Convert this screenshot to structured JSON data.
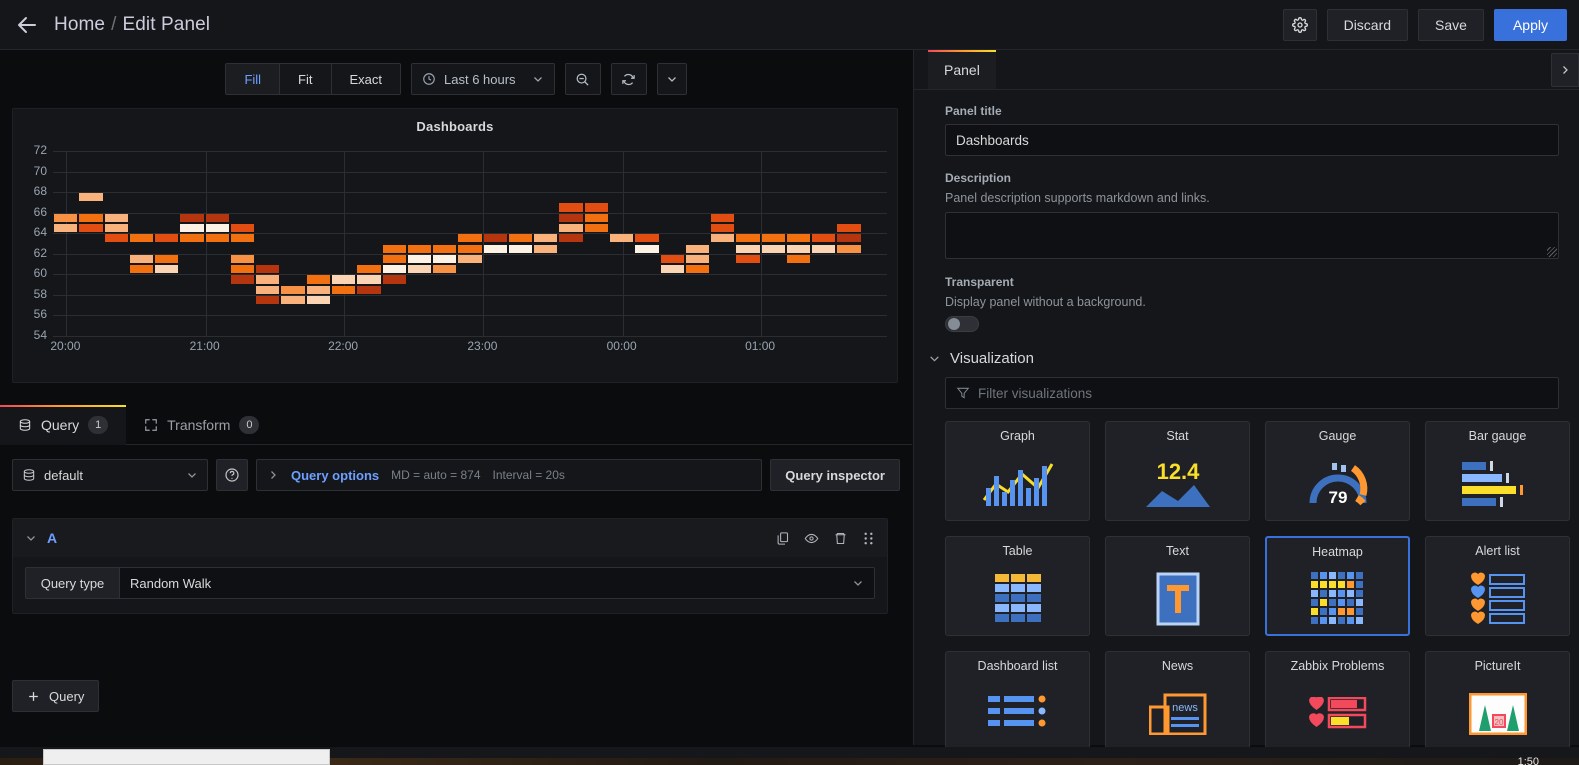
{
  "topnav": {
    "back_icon": "arrow-left-icon",
    "breadcrumb_home": "Home",
    "breadcrumb_sep": "/",
    "breadcrumb_current": "Edit Panel",
    "settings_icon": "gear-icon",
    "discard_label": "Discard",
    "save_label": "Save",
    "apply_label": "Apply",
    "accent_primary": "#3871dc"
  },
  "toolbar": {
    "fit_modes": [
      "Fill",
      "Fit",
      "Exact"
    ],
    "active_fit_mode": "Fill",
    "time_range": "Last 6 hours",
    "clock_icon": "clock-icon",
    "timepicker_caret_icon": "chevron-down-icon",
    "zoom_out_icon": "zoom-out-icon",
    "refresh_icon": "refresh-icon",
    "refresh_caret_icon": "chevron-down-icon"
  },
  "panel": {
    "title": "Dashboards"
  },
  "chart_data": {
    "type": "heatmap",
    "title": "Dashboards",
    "xlabel": "",
    "ylabel": "",
    "grid": true,
    "legend": "none",
    "ylim": [
      54,
      72
    ],
    "ytick_labels": [
      72,
      70,
      68,
      66,
      64,
      62,
      60,
      58,
      56,
      54
    ],
    "xtick_labels": [
      "20:00",
      "21:00",
      "22:00",
      "23:00",
      "00:00",
      "01:00"
    ],
    "xtick_fractions": [
      0.016,
      0.183,
      0.349,
      0.516,
      0.683,
      0.849
    ],
    "bucket_height": 1,
    "color_scale": [
      "#932b0c",
      "#b5350f",
      "#e24d12",
      "#f2700f",
      "#f79245",
      "#f9b27b",
      "#fbd4b4",
      "#fdf2e4"
    ],
    "cells": [
      [
        0,
        65,
        4
      ],
      [
        0,
        64,
        5
      ],
      [
        1,
        67,
        5
      ],
      [
        1,
        65,
        3
      ],
      [
        1,
        64,
        2
      ],
      [
        2,
        65,
        5
      ],
      [
        2,
        64,
        5
      ],
      [
        2,
        63,
        2
      ],
      [
        3,
        63,
        3
      ],
      [
        3,
        61,
        5
      ],
      [
        3,
        60,
        3
      ],
      [
        4,
        63,
        2
      ],
      [
        4,
        61,
        3
      ],
      [
        4,
        60,
        6
      ],
      [
        5,
        65,
        1
      ],
      [
        5,
        63,
        3
      ],
      [
        5,
        64,
        7
      ],
      [
        6,
        65,
        1
      ],
      [
        6,
        64,
        7
      ],
      [
        6,
        63,
        3
      ],
      [
        7,
        64,
        2
      ],
      [
        7,
        63,
        3
      ],
      [
        7,
        61,
        4
      ],
      [
        7,
        60,
        3
      ],
      [
        7,
        59,
        1
      ],
      [
        8,
        60,
        1
      ],
      [
        8,
        59,
        5
      ],
      [
        8,
        58,
        5
      ],
      [
        8,
        57,
        1
      ],
      [
        9,
        58,
        4
      ],
      [
        9,
        57,
        5
      ],
      [
        10,
        58,
        5
      ],
      [
        10,
        57,
        6
      ],
      [
        10,
        59,
        3
      ],
      [
        11,
        58,
        3
      ],
      [
        11,
        59,
        6
      ],
      [
        12,
        59,
        6
      ],
      [
        12,
        58,
        1
      ],
      [
        12,
        60,
        3
      ],
      [
        13,
        59,
        1
      ],
      [
        13,
        60,
        7
      ],
      [
        13,
        61,
        3
      ],
      [
        13,
        62,
        3
      ],
      [
        14,
        60,
        6
      ],
      [
        14,
        61,
        7
      ],
      [
        14,
        62,
        3
      ],
      [
        15,
        60,
        4
      ],
      [
        15,
        61,
        7
      ],
      [
        15,
        62,
        3
      ],
      [
        16,
        61,
        5
      ],
      [
        16,
        62,
        3
      ],
      [
        16,
        63,
        3
      ],
      [
        17,
        62,
        7
      ],
      [
        17,
        63,
        1
      ],
      [
        18,
        62,
        7
      ],
      [
        18,
        63,
        3
      ],
      [
        19,
        62,
        5
      ],
      [
        19,
        63,
        5
      ],
      [
        20,
        64,
        5
      ],
      [
        20,
        65,
        1
      ],
      [
        20,
        66,
        2
      ],
      [
        20,
        63,
        1
      ],
      [
        21,
        65,
        3
      ],
      [
        21,
        66,
        2
      ],
      [
        21,
        64,
        3
      ],
      [
        22,
        63,
        5
      ],
      [
        23,
        63,
        2
      ],
      [
        23,
        62,
        7
      ],
      [
        24,
        61,
        2
      ],
      [
        24,
        60,
        6
      ],
      [
        25,
        61,
        5
      ],
      [
        25,
        62,
        5
      ],
      [
        25,
        60,
        3
      ],
      [
        26,
        63,
        5
      ],
      [
        26,
        64,
        2
      ],
      [
        26,
        65,
        2
      ],
      [
        27,
        63,
        3
      ],
      [
        27,
        62,
        6
      ],
      [
        27,
        61,
        2
      ],
      [
        28,
        63,
        3
      ],
      [
        28,
        62,
        6
      ],
      [
        29,
        63,
        3
      ],
      [
        29,
        62,
        6
      ],
      [
        29,
        61,
        3
      ],
      [
        30,
        63,
        2
      ],
      [
        30,
        62,
        6
      ],
      [
        31,
        63,
        1
      ],
      [
        31,
        64,
        2
      ],
      [
        31,
        62,
        4
      ]
    ]
  },
  "query_section": {
    "tabs": [
      {
        "label": "Query",
        "badge": "1",
        "icon": "database-icon",
        "active": true
      },
      {
        "label": "Transform",
        "badge": "0",
        "icon": "transform-icon",
        "active": false
      }
    ],
    "datasource": "default",
    "datasource_icon": "database-icon",
    "help_icon": "question-circle-icon",
    "expand_icon": "chevron-right-icon",
    "query_options_label": "Query options",
    "query_options_md": "MD = auto = 874",
    "query_options_interval": "Interval = 20s",
    "query_inspector_label": "Query inspector",
    "query_row": {
      "collapse_icon": "chevron-down-icon",
      "ref_id": "A",
      "actions": [
        "copy-icon",
        "eye-icon",
        "trash-icon",
        "drag-handle-icon"
      ],
      "query_type_label": "Query type",
      "query_type_value": "Random Walk",
      "caret_icon": "chevron-down-icon"
    },
    "add_query_label": "Query",
    "add_query_icon": "plus-icon"
  },
  "options_pane": {
    "tab_label": "Panel",
    "collapse_icon": "chevron-right-icon",
    "panel_title_label": "Panel title",
    "panel_title_value": "Dashboards",
    "description_label": "Description",
    "description_help": "Panel description supports markdown and links.",
    "description_value": "",
    "transparent_label": "Transparent",
    "transparent_help": "Display panel without a background.",
    "transparent_on": false,
    "visualization_label": "Visualization",
    "visualization_caret_icon": "chevron-down-icon",
    "filter_icon": "filter-icon",
    "filter_placeholder": "Filter visualizations",
    "visualizations": [
      {
        "name": "Graph",
        "art": "graph",
        "selected": false
      },
      {
        "name": "Stat",
        "art": "stat",
        "selected": false,
        "value": "12.4"
      },
      {
        "name": "Gauge",
        "art": "gauge",
        "selected": false,
        "value": "79"
      },
      {
        "name": "Bar gauge",
        "art": "bargauge",
        "selected": false
      },
      {
        "name": "Table",
        "art": "table",
        "selected": false
      },
      {
        "name": "Text",
        "art": "text",
        "selected": false,
        "value": "T"
      },
      {
        "name": "Heatmap",
        "art": "heatmap",
        "selected": true
      },
      {
        "name": "Alert list",
        "art": "alertlist",
        "selected": false
      },
      {
        "name": "Dashboard list",
        "art": "dashlist",
        "selected": false
      },
      {
        "name": "News",
        "art": "news",
        "selected": false,
        "value": "news"
      },
      {
        "name": "Zabbix Problems",
        "art": "zabbix",
        "selected": false
      },
      {
        "name": "PictureIt",
        "art": "pictureit",
        "selected": false
      }
    ]
  },
  "taskbar": {
    "clock": "1:50"
  }
}
